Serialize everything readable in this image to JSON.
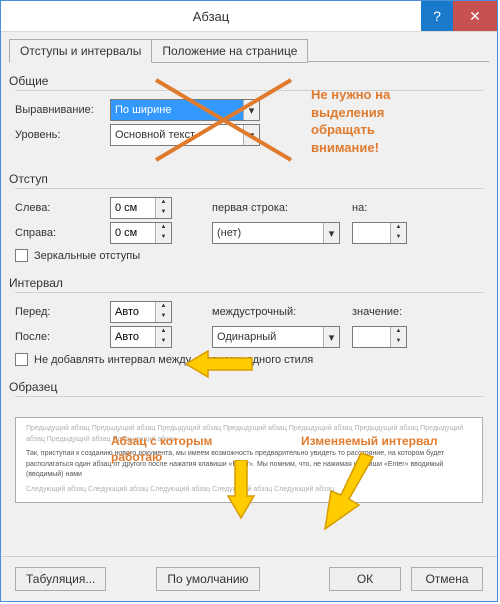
{
  "window": {
    "title": "Абзац"
  },
  "tabs": {
    "t1": "Отступы и интервалы",
    "t2": "Положение на странице"
  },
  "groups": {
    "general": "Общие",
    "indent": "Отступ",
    "spacing": "Интервал",
    "preview": "Образец"
  },
  "general": {
    "align_label": "Выравнивание:",
    "align_value": "По ширине",
    "level_label": "Уровень:",
    "level_value": "Основной текст"
  },
  "indent": {
    "left_label": "Слева:",
    "left_value": "0 см",
    "right_label": "Справа:",
    "right_value": "0 см",
    "firstline_label": "первая строка:",
    "firstline_value": "(нет)",
    "by_label": "на:",
    "by_value": "",
    "mirror": "Зеркальные отступы"
  },
  "spacing": {
    "before_label": "Перед:",
    "before_value": "Авто",
    "after_label": "После:",
    "after_value": "Авто",
    "line_label": "междустрочный:",
    "line_value": "Одинарный",
    "val_label": "значение:",
    "val_value": "",
    "noadd": "Не добавлять интервал между абзацами одного стиля"
  },
  "preview": {
    "prev": "Предыдущий абзац Предыдущий абзац Предыдущий абзац Предыдущий абзац Предыдущий абзац Предыдущий абзац Предыдущий абзац Предыдущий абзац Предыдущий абзац",
    "main": "Так, приступая к созданию нового документа, мы имеем возможность предварительно увидеть то расстояние, на котором будет располагаться один абзац от другого после нажатия клавиши «Enter». Мы помним, что, не нажимая клавиши «Enter» вводимый (вводимый) нами",
    "next": "Следующий абзац Следующий абзац Следующий абзац Следующий абзац Следующий абзац"
  },
  "buttons": {
    "tabs": "Табуляция...",
    "default": "По умолчанию",
    "ok": "ОК",
    "cancel": "Отмена"
  },
  "annotations": {
    "a1": "Не нужно на\nвыделения\nобращать\nвнимание!",
    "a2": "Абзац с которым\nработаю",
    "a3": "Изменяемый интервал"
  }
}
